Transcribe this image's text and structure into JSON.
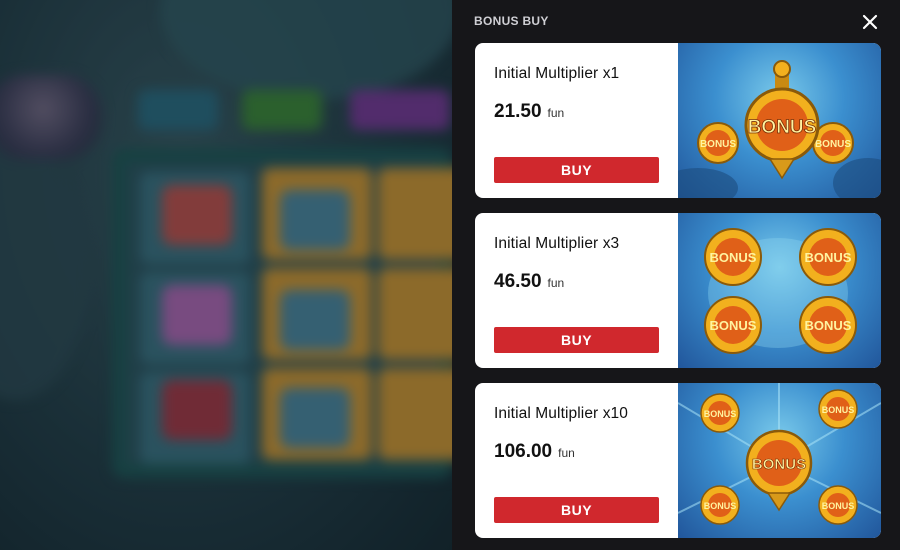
{
  "panel": {
    "title": "BONUS BUY",
    "close_icon": "close-icon"
  },
  "offers": [
    {
      "name": "Initial Multiplier x1",
      "price": "21.50",
      "currency": "fun",
      "buy_label": "BUY",
      "art_text": "BONUS"
    },
    {
      "name": "Initial Multiplier x3",
      "price": "46.50",
      "currency": "fun",
      "buy_label": "BUY",
      "art_text": "BONUS"
    },
    {
      "name": "Initial Multiplier x10",
      "price": "106.00",
      "currency": "fun",
      "buy_label": "BUY",
      "art_text": "BONUS"
    }
  ],
  "colors": {
    "panel_bg": "#161619",
    "buy_button": "#d0282d",
    "card_bg": "#ffffff",
    "art_sky": "#3b8fcf",
    "art_gold": "#f2b01e"
  }
}
